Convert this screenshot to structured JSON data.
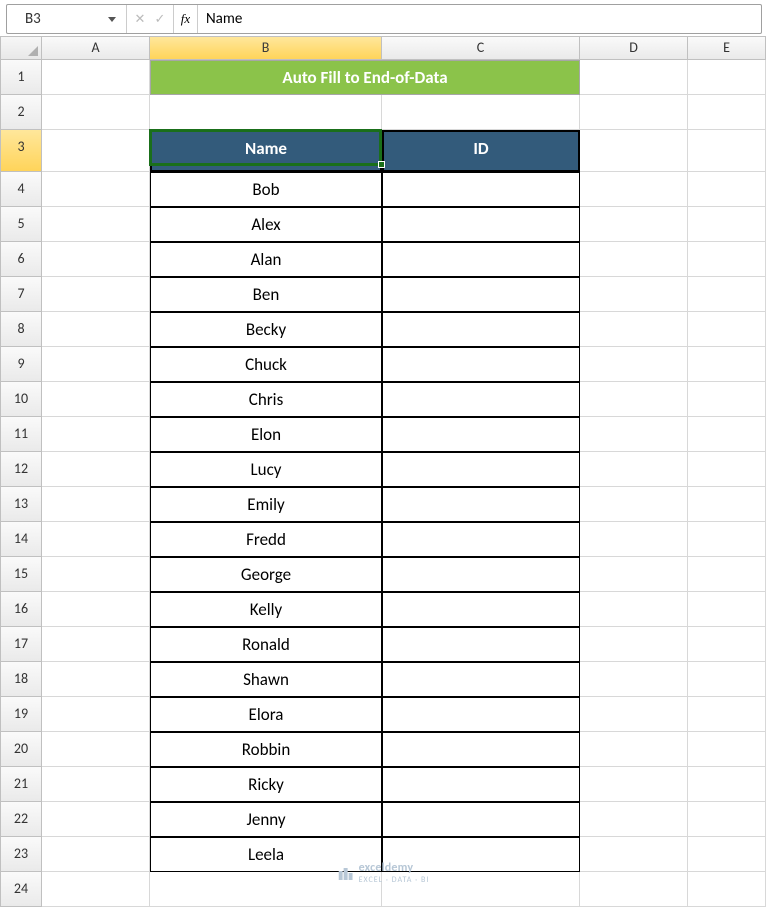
{
  "namebox": {
    "value": "B3"
  },
  "formula": {
    "fx_label": "fx",
    "value": "Name"
  },
  "columns": [
    "A",
    "B",
    "C",
    "D",
    "E"
  ],
  "selected_column": "B",
  "selected_row": 3,
  "row_numbers": [
    1,
    2,
    3,
    4,
    5,
    6,
    7,
    8,
    9,
    10,
    11,
    12,
    13,
    14,
    15,
    16,
    17,
    18,
    19,
    20,
    21,
    22,
    23,
    24
  ],
  "title": "Auto Fill to End-of-Data",
  "headers": {
    "name": "Name",
    "id": "ID"
  },
  "names": [
    "Bob",
    "Alex",
    "Alan",
    "Ben",
    "Becky",
    "Chuck",
    "Chris",
    "Elon",
    "Lucy",
    "Emily",
    "Fredd",
    "George",
    "Kelly",
    "Ronald",
    "Shawn",
    "Elora",
    "Robbin",
    "Ricky",
    "Jenny",
    "Leela"
  ],
  "watermark": {
    "brand": "exceldemy",
    "tag": "EXCEL · DATA · BI"
  },
  "colors": {
    "title_bg": "#8bc34a",
    "header_bg": "#335b7b",
    "select_outline": "#1a6f1a"
  }
}
